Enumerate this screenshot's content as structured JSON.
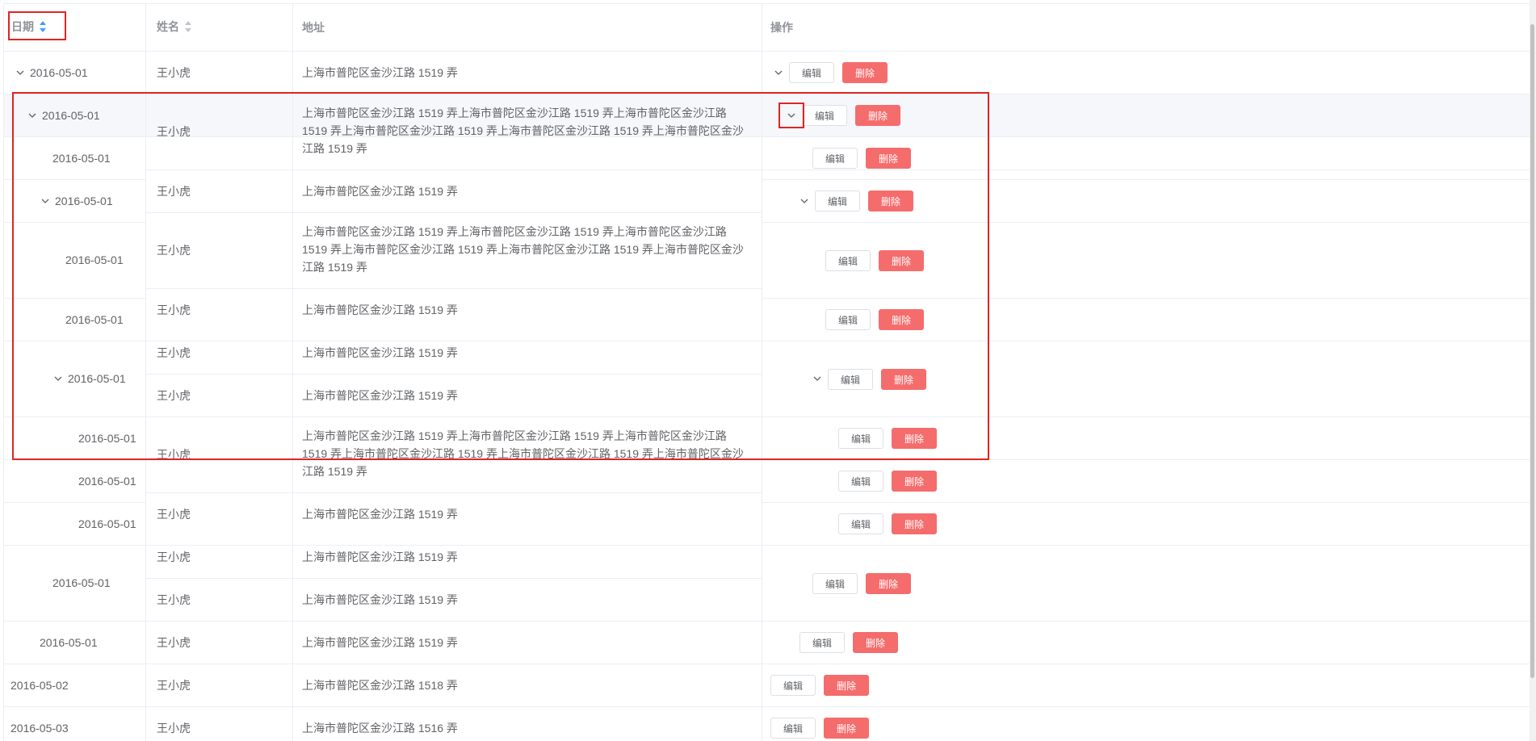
{
  "columns": {
    "date": "日期",
    "name": "姓名",
    "address": "地址",
    "actions": "操作"
  },
  "buttons": {
    "edit": "编辑",
    "delete": "删除"
  },
  "cells": {
    "dates": [
      "2016-05-01",
      "2016-05-01",
      "2016-05-01",
      "2016-05-01",
      "2016-05-01",
      "2016-05-01",
      "2016-05-01",
      "2016-05-01",
      "2016-05-01",
      "2016-05-01",
      "2016-05-01",
      "2016-05-01",
      "2016-05-01",
      "2016-05-02",
      "2016-05-03"
    ],
    "name": "王小虎",
    "addr_short": "上海市普陀区金沙江路 1519 弄",
    "addr_long": "上海市普陀区金沙江路 1519 弄上海市普陀区金沙江路 1519 弄上海市普陀区金沙江路 1519 弄上海市普陀区金沙江路 1519 弄上海市普陀区金沙江路 1519 弄上海市普陀区金沙江路 1519 弄",
    "addr_1518": "上海市普陀区金沙江路 1518 弄",
    "addr_1516": "上海市普陀区金沙江路 1516 弄"
  },
  "colors": {
    "delete": "#f56c6c",
    "highlight": "#e02424",
    "border": "#ebeef5"
  }
}
